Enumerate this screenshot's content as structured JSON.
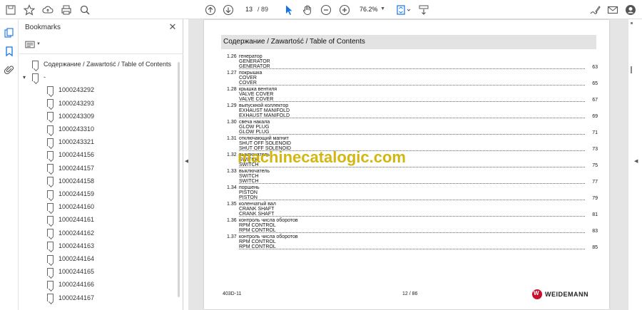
{
  "toolbar": {
    "page_current": "13",
    "page_total": "/ 89",
    "zoom": "76.2%"
  },
  "panel": {
    "title": "Bookmarks",
    "close": "✕"
  },
  "bookmarks": [
    {
      "label": "Содержание / Zawartość / Table of Contents",
      "indent": 0,
      "chev": ""
    },
    {
      "label": "-",
      "indent": 0,
      "chev": "▾"
    },
    {
      "label": "1000243292",
      "indent": 1,
      "chev": ""
    },
    {
      "label": "1000243293",
      "indent": 1,
      "chev": ""
    },
    {
      "label": "1000243309",
      "indent": 1,
      "chev": ""
    },
    {
      "label": "1000243310",
      "indent": 1,
      "chev": ""
    },
    {
      "label": "1000243321",
      "indent": 1,
      "chev": ""
    },
    {
      "label": "1000244156",
      "indent": 1,
      "chev": ""
    },
    {
      "label": "1000244157",
      "indent": 1,
      "chev": ""
    },
    {
      "label": "1000244158",
      "indent": 1,
      "chev": ""
    },
    {
      "label": "1000244159",
      "indent": 1,
      "chev": ""
    },
    {
      "label": "1000244160",
      "indent": 1,
      "chev": ""
    },
    {
      "label": "1000244161",
      "indent": 1,
      "chev": ""
    },
    {
      "label": "1000244162",
      "indent": 1,
      "chev": ""
    },
    {
      "label": "1000244163",
      "indent": 1,
      "chev": ""
    },
    {
      "label": "1000244164",
      "indent": 1,
      "chev": ""
    },
    {
      "label": "1000244165",
      "indent": 1,
      "chev": ""
    },
    {
      "label": "1000244166",
      "indent": 1,
      "chev": ""
    },
    {
      "label": "1000244167",
      "indent": 1,
      "chev": ""
    }
  ],
  "document": {
    "header": "Содержание / Zawartość / Table of Contents",
    "toc": [
      {
        "num": "1.26",
        "lines": [
          "генератор",
          "GENERATOR",
          "GENERATOR"
        ],
        "page": "63"
      },
      {
        "num": "1.27",
        "lines": [
          "покрышка",
          "COVER",
          "COVER"
        ],
        "page": "65"
      },
      {
        "num": "1.28",
        "lines": [
          "крышка вентиля",
          "VALVE COVER",
          "VALVE COVER"
        ],
        "page": "67"
      },
      {
        "num": "1.29",
        "lines": [
          "выпускной коллектор",
          "EXHAUST MANIFOLD",
          "EXHAUST MANIFOLD"
        ],
        "page": "69"
      },
      {
        "num": "1.30",
        "lines": [
          "свеча накала",
          "GLOW PLUG",
          "GLOW PLUG"
        ],
        "page": "71"
      },
      {
        "num": "1.31",
        "lines": [
          "отключающий магнит",
          "SHUT OFF SOLENOID",
          "SHUT OFF SOLENOID"
        ],
        "page": "73"
      },
      {
        "num": "1.32",
        "lines": [
          "выключатель",
          "SWITCH",
          "SWITCH"
        ],
        "page": "75"
      },
      {
        "num": "1.33",
        "lines": [
          "выключатель",
          "SWITCH",
          "SWITCH"
        ],
        "page": "77"
      },
      {
        "num": "1.34",
        "lines": [
          "поршень",
          "PISTON",
          "PISTON"
        ],
        "page": "79"
      },
      {
        "num": "1.35",
        "lines": [
          "коленчатый вал",
          "CRANK SHAFT",
          "CRANK SHAFT"
        ],
        "page": "81"
      },
      {
        "num": "1.36",
        "lines": [
          "контроль числа оборотов",
          "RPM CONTROL",
          "RPM CONTROL"
        ],
        "page": "83"
      },
      {
        "num": "1.37",
        "lines": [
          "контроль числа оборотов",
          "RPM CONTROL",
          "RPM CONTROL"
        ],
        "page": "85"
      }
    ],
    "footer_code": "403D-11",
    "footer_page": "12 / 86",
    "brand": "WEIDEMANN",
    "watermark": "machinecatalogic.com"
  }
}
